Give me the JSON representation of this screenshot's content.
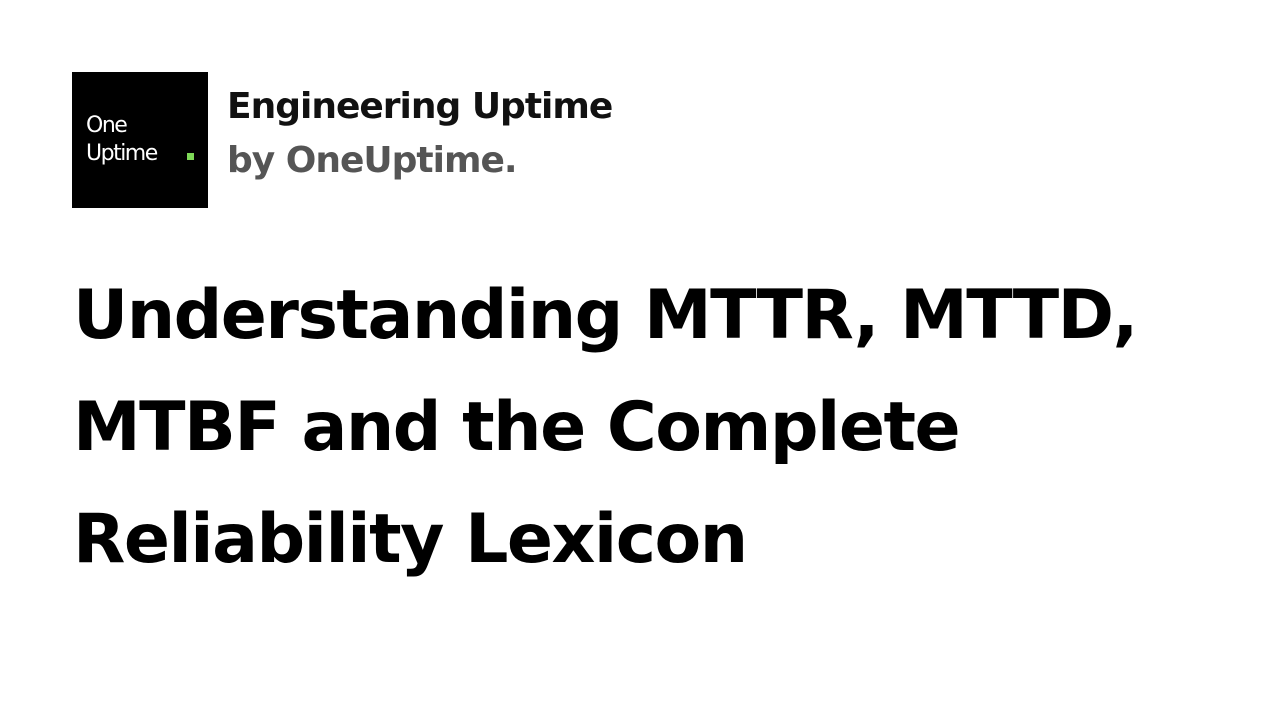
{
  "logo": {
    "line1": "One",
    "line2": "Uptime",
    "dot_color": "#7ED957",
    "background_color": "#000000"
  },
  "brand": {
    "title": "Engineering Uptime",
    "subtitle": "by OneUptime."
  },
  "headline": {
    "lines": [
      "Understanding MTTR, MTTD,",
      "MTBF and the Complete",
      "Reliability Lexicon"
    ]
  }
}
